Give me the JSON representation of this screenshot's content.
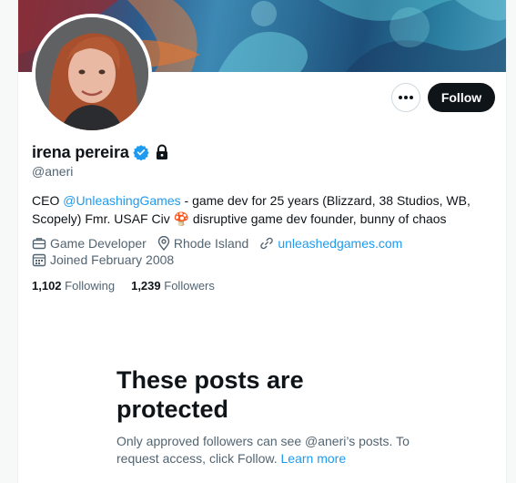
{
  "profile": {
    "display_name": "irena pereira",
    "handle": "@aneri",
    "verified_icon": "verified-badge-icon",
    "protected_icon": "lock-icon",
    "follow_label": "Follow",
    "more_icon": "more-options-icon",
    "bio": {
      "prefix": "CEO ",
      "mention": "@UnleashingGames",
      "text": " - game dev for 25 years (Blizzard, 38 Studios, WB, Scopely) Fmr. USAF Civ ",
      "emoji": "🍄",
      "suffix": " disruptive game dev founder, bunny of chaos"
    },
    "category": "Game Developer",
    "location": "Rhode Island",
    "website": "unleashedgames.com",
    "joined": "Joined February 2008",
    "following_count": "1,102",
    "following_label": "Following",
    "followers_count": "1,239",
    "followers_label": "Followers"
  },
  "protected": {
    "title": "These posts are protected",
    "description": "Only approved followers can see @aneri’s posts. To request access, click Follow.",
    "learn_more": "Learn more"
  },
  "colors": {
    "accent": "#1d9bf0",
    "primary_text": "#0f1419",
    "secondary_text": "#536471",
    "follow_button": "#0f1419"
  }
}
